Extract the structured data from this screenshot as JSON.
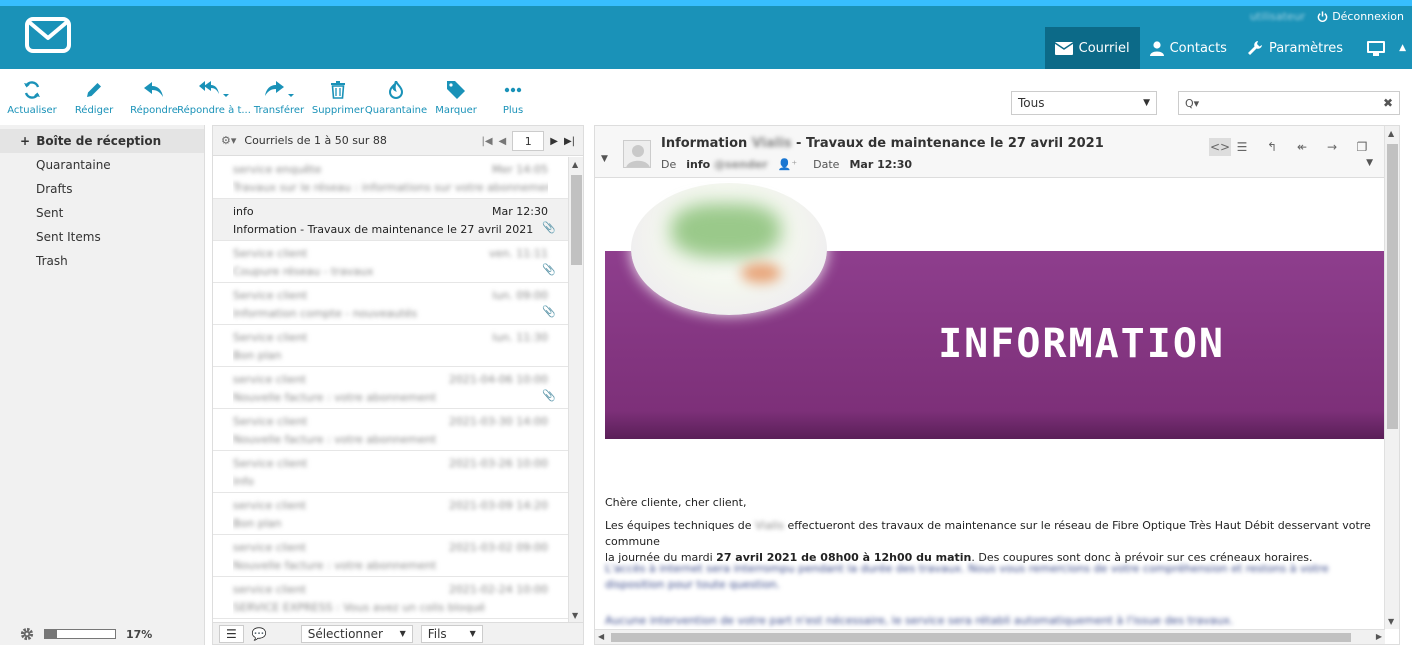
{
  "header": {
    "user": "utilisateur",
    "logout": "Déconnexion",
    "nav": [
      {
        "label": "Courriel",
        "icon": "envelope-icon",
        "active": true
      },
      {
        "label": "Contacts",
        "icon": "person-icon",
        "active": false
      },
      {
        "label": "Paramètres",
        "icon": "wrench-icon",
        "active": false
      }
    ]
  },
  "toolbar": {
    "buttons": [
      "Actualiser",
      "Rédiger",
      "Répondre",
      "Répondre à t...",
      "Transférer",
      "Supprimer",
      "Quarantaine",
      "Marquer",
      "Plus"
    ],
    "filter_value": "Tous",
    "search_placeholder": "Q▾"
  },
  "folders": {
    "items": [
      "Boîte de réception",
      "Quarantaine",
      "Drafts",
      "Sent",
      "Sent Items",
      "Trash"
    ],
    "quota": "17%",
    "quota_fraction": 0.17
  },
  "list": {
    "header": "Courriels de 1 à 50 sur 88",
    "page": "1",
    "rows": [
      {
        "from": "service enquête",
        "date": "Mer 14:05",
        "subject": "Travaux sur le réseau : informations sur votre abonnement",
        "attach": false
      },
      {
        "from": "info",
        "date": "Mar 12:30",
        "subject": "Information  - Travaux de maintenance le 27 avril 2021",
        "attach": true
      },
      {
        "from": "Service client",
        "date": "ven. 11:11",
        "subject": "Coupure réseau - travaux",
        "attach": true
      },
      {
        "from": "Service client",
        "date": "lun. 09:00",
        "subject": "Information compte - nouveautés",
        "attach": true
      },
      {
        "from": "Service client",
        "date": "lun. 11:30",
        "subject": "Bon plan",
        "attach": false
      },
      {
        "from": "service client",
        "date": "2021-04-06 10:00",
        "subject": "Nouvelle facture : votre abonnement",
        "attach": true
      },
      {
        "from": "Service client",
        "date": "2021-03-30 14:00",
        "subject": "Nouvelle facture : votre abonnement",
        "attach": false
      },
      {
        "from": "Service client",
        "date": "2021-03-26 10:00",
        "subject": "Info",
        "attach": false
      },
      {
        "from": "service client",
        "date": "2021-03-09 14:20",
        "subject": "Bon plan",
        "attach": false
      },
      {
        "from": "service client",
        "date": "2021-03-02 09:00",
        "subject": "Nouvelle facture : votre abonnement",
        "attach": false
      },
      {
        "from": "service client",
        "date": "2021-02-24 10:00",
        "subject": "SERVICE EXPRESS : Vous avez un colis bloqué",
        "attach": false
      }
    ],
    "footer_select": "Sélectionner",
    "footer_thread": "Fils"
  },
  "preview": {
    "subject_prefix": "Information",
    "subject_rest": "- Travaux de maintenance le 27 avril 2021",
    "from_label": "De",
    "from_value": "info",
    "date_label": "Date",
    "date_value": "Mar 12:30",
    "banner_title": "INFORMATION",
    "greeting": "Chère cliente, cher client,",
    "para1_a": "Les équipes techniques de",
    "para1_b": "effectueront des travaux de maintenance sur le réseau de Fibre Optique Très Haut Débit desservant votre commune",
    "para1_c": "la journée du mardi",
    "para1_bold": "27 avril 2021 de 08h00 à 12h00 du matin",
    "para1_d": ". Des coupures sont donc à prévoir sur ces créneaux horaires.",
    "para2": "L'accès à internet sera interrompu pendant la durée des travaux. Nous vous remercions de votre compréhension et restons à votre disposition pour toute question.",
    "para3": "Aucune intervention de votre part n'est nécessaire, le service sera rétabli automatiquement à l'issue des travaux."
  }
}
